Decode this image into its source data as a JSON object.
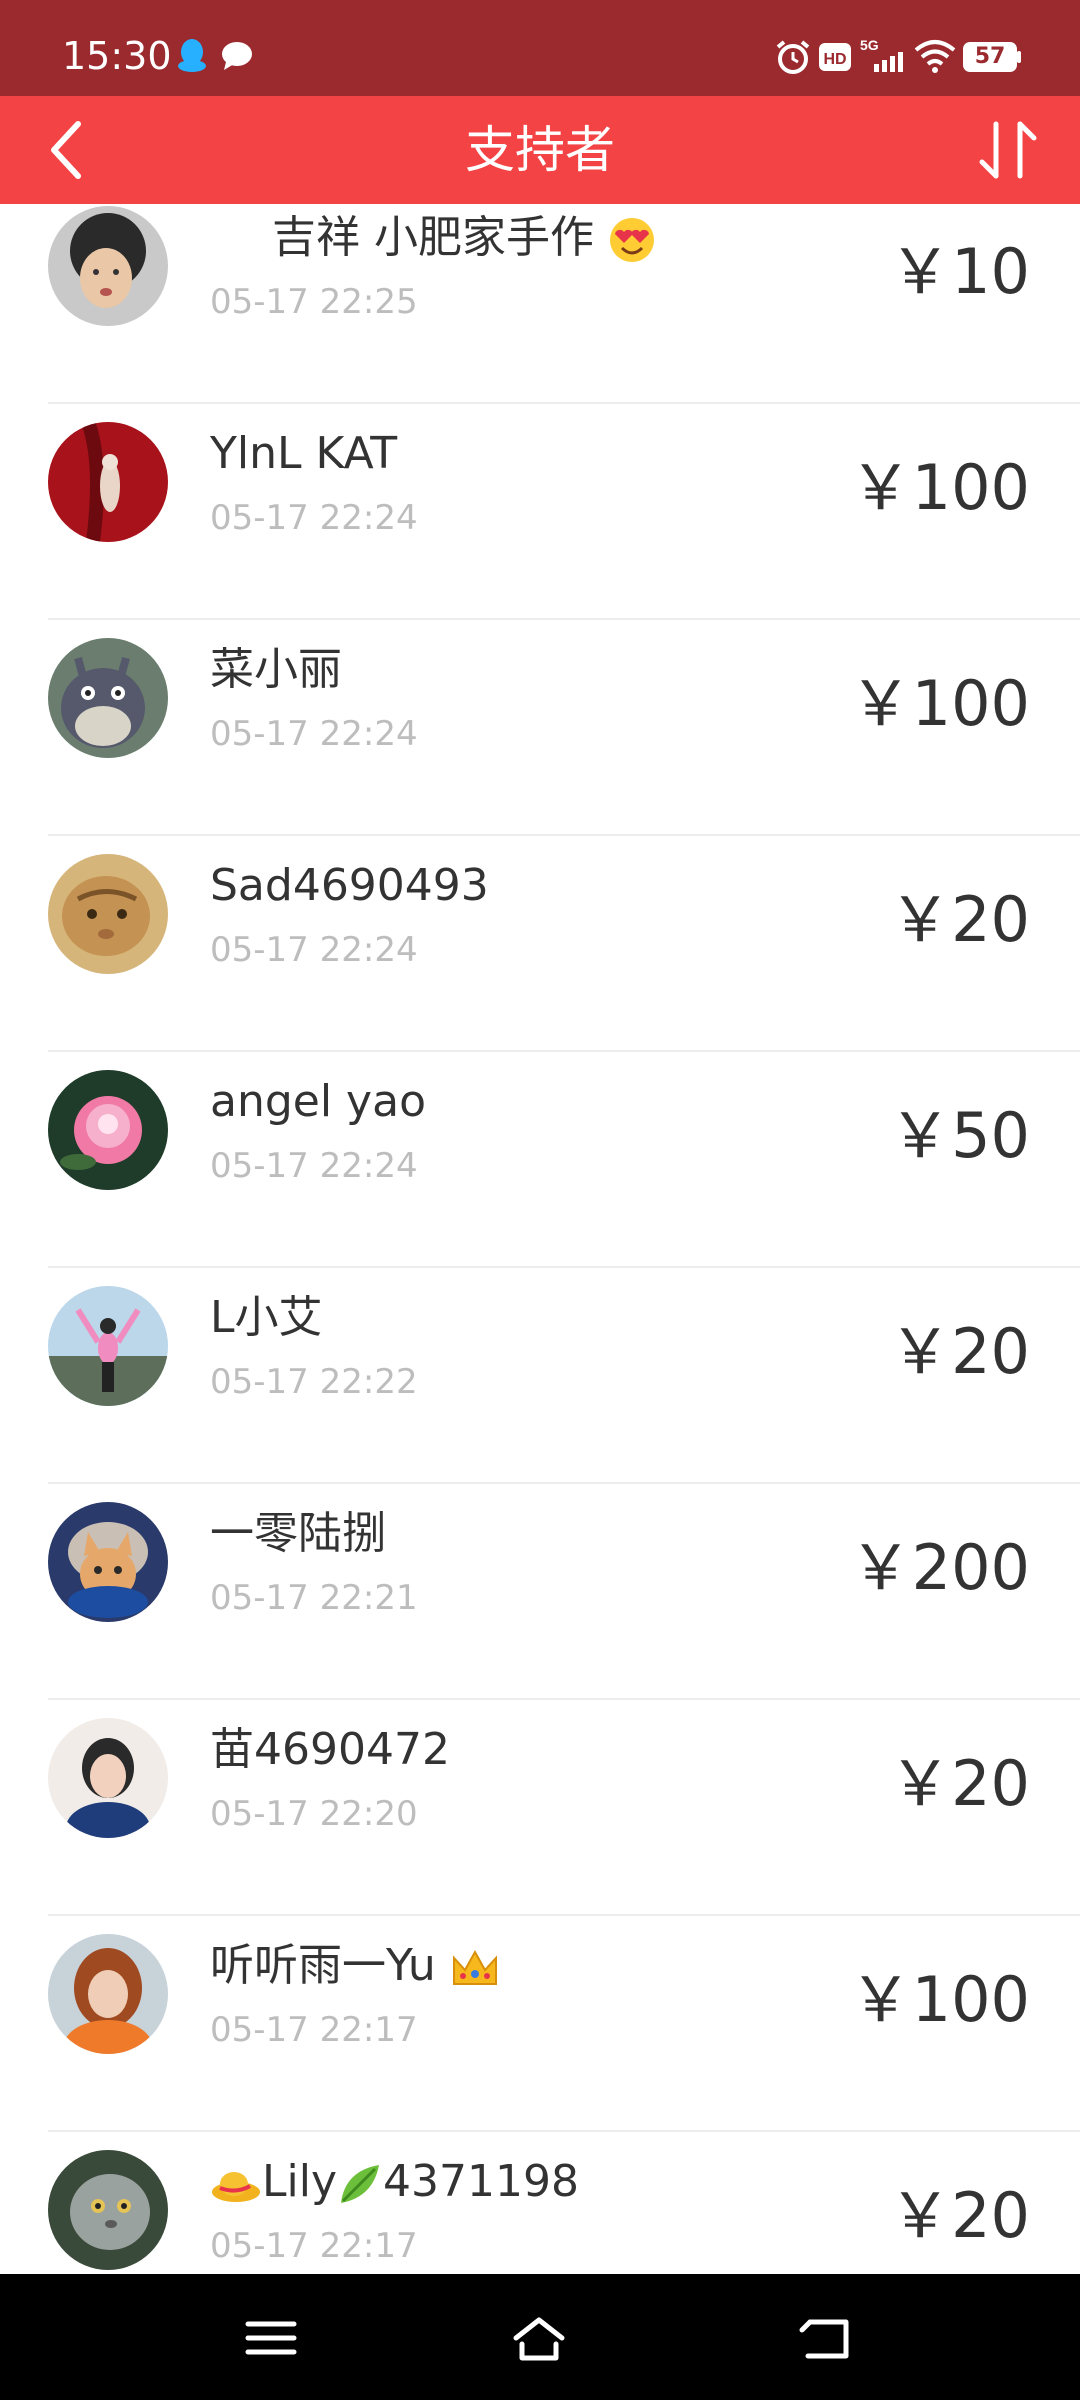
{
  "status_bar": {
    "time": "15:30",
    "battery": "57",
    "network": "5G",
    "icons": [
      "qq-icon",
      "message-icon",
      "alarm-icon",
      "hd-icon",
      "signal-icon",
      "wifi-icon",
      "battery-icon"
    ]
  },
  "header": {
    "title": "支持者",
    "back_icon": "chevron-left-icon",
    "sort_icon": "sort-icon",
    "background_color": "#f44345"
  },
  "supporters": [
    {
      "name": "吉祥 小肥家手作",
      "name_suffix_icon": "heart-eyes-emoji",
      "time": "05-17 22:25",
      "amount": "￥10"
    },
    {
      "name": "YlnL KAT",
      "time": "05-17 22:24",
      "amount": "￥100"
    },
    {
      "name": "菜小丽",
      "time": "05-17 22:24",
      "amount": "￥100"
    },
    {
      "name": "Sad4690493",
      "time": "05-17 22:24",
      "amount": "￥20"
    },
    {
      "name": "angel yao",
      "time": "05-17 22:24",
      "amount": "￥50"
    },
    {
      "name": "L小艾",
      "time": "05-17 22:22",
      "amount": "￥20"
    },
    {
      "name": "一零陆捌",
      "time": "05-17 22:21",
      "amount": "￥200"
    },
    {
      "name": "苗4690472",
      "time": "05-17 22:20",
      "amount": "￥20"
    },
    {
      "name": "听听雨一Yu",
      "name_suffix_icon": "crown-emoji",
      "time": "05-17 22:17",
      "amount": "￥100"
    },
    {
      "name_prefix_icon": "hat-emoji",
      "name": "Lily",
      "name_mid_icon": "leaf-emoji",
      "name_tail": "4371198",
      "time": "05-17 22:17",
      "amount": "￥20"
    }
  ],
  "nav_bar": {
    "icons": [
      "menu-icon",
      "home-icon",
      "back-icon"
    ]
  },
  "colors": {
    "status_bar": "#9b2a2e",
    "header": "#f44345",
    "amount_text": "#333333",
    "time_text": "#bdbdbd"
  }
}
